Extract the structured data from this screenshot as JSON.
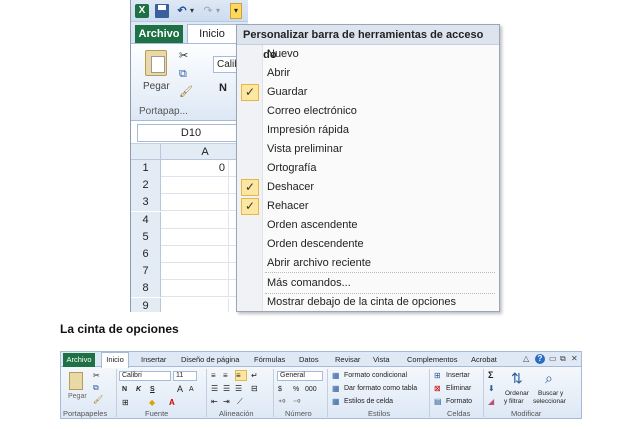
{
  "qat": {
    "logo": "X",
    "undo_arrow": "▾",
    "redo_arrow": "▾",
    "customize_arrow": "▾"
  },
  "window1": {
    "tab_archivo": "Archivo",
    "tab_inicio": "Inicio",
    "paste_label": "Pegar",
    "font_value": "Calib",
    "bold_label": "N",
    "clipboard_group": "Portapap...",
    "name_box": "D10",
    "column_header": "A",
    "rows": [
      {
        "num": "1",
        "value": "0"
      },
      {
        "num": "2",
        "value": ""
      },
      {
        "num": "3",
        "value": ""
      },
      {
        "num": "4",
        "value": ""
      },
      {
        "num": "5",
        "value": ""
      },
      {
        "num": "6",
        "value": ""
      },
      {
        "num": "7",
        "value": ""
      },
      {
        "num": "8",
        "value": ""
      },
      {
        "num": "9",
        "value": ""
      }
    ]
  },
  "menu": {
    "title": "Personalizar barra de herramientas de acceso rápido",
    "items": [
      {
        "label": "Nuevo",
        "checked": false
      },
      {
        "label": "Abrir",
        "checked": false
      },
      {
        "label": "Guardar",
        "checked": true
      },
      {
        "label": "Correo electrónico",
        "checked": false
      },
      {
        "label": "Impresión rápida",
        "checked": false
      },
      {
        "label": "Vista preliminar",
        "checked": false
      },
      {
        "label": "Ortografía",
        "checked": false
      },
      {
        "label": "Deshacer",
        "checked": true
      },
      {
        "label": "Rehacer",
        "checked": true
      },
      {
        "label": "Orden ascendente",
        "checked": false
      },
      {
        "label": "Orden descendente",
        "checked": false
      },
      {
        "label": "Abrir archivo reciente",
        "checked": false
      }
    ],
    "more_commands": "Más comandos...",
    "show_below": "Mostrar debajo de la cinta de opciones",
    "check_glyph": "✓"
  },
  "section_title": "La cinta de opciones",
  "ribbon2": {
    "tabs": [
      "Archivo",
      "Inicio",
      "Insertar",
      "Diseño de página",
      "Fórmulas",
      "Datos",
      "Revisar",
      "Vista",
      "Complementos",
      "Acrobat"
    ],
    "paste_label": "Pegar",
    "font_name": "Calibri",
    "font_size": "11",
    "bold": "N",
    "italic": "K",
    "underline": "S",
    "grow_font": "A",
    "shrink_font": "A",
    "number_format": "General",
    "percent": "%",
    "thousands": "000",
    "currency": "$",
    "conditional_format": "Formato condicional",
    "format_as_table": "Dar formato como tabla",
    "cell_styles": "Estilos de celda",
    "insert": "Insertar",
    "delete": "Eliminar",
    "format": "Formato",
    "sum": "Σ",
    "sort_filter_1": "Ordenar",
    "sort_filter_2": "y filtrar",
    "find_select_1": "Buscar y",
    "find_select_2": "seleccionar",
    "groups": [
      "Portapapeles",
      "Fuente",
      "Alineación",
      "Número",
      "Estilos",
      "Celdas",
      "Modificar"
    ]
  },
  "colors": {
    "excel_green": "#1e7145",
    "ribbon_border": "#a7bad6",
    "check_bg": "#fde6a0"
  }
}
